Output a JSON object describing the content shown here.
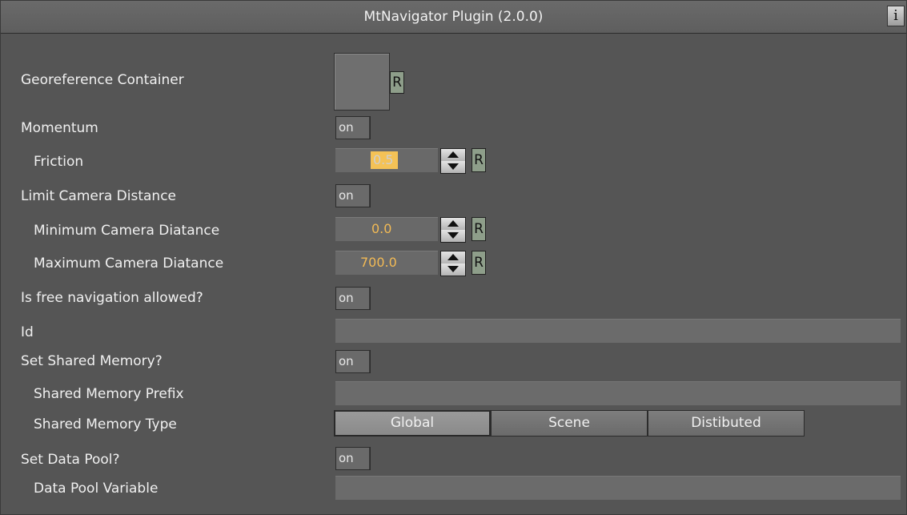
{
  "window": {
    "title": "MtNavigator Plugin (2.0.0)",
    "info_label": "i"
  },
  "rows": {
    "georeference": {
      "label": "Georeference Container",
      "reset": "R"
    },
    "momentum": {
      "label": "Momentum",
      "toggle": "on"
    },
    "friction": {
      "label": "Friction",
      "value": "0.5",
      "reset": "R"
    },
    "limit_camera": {
      "label": "Limit Camera Distance",
      "toggle": "on"
    },
    "min_camera": {
      "label": "Minimum Camera Diatance",
      "value": "0.0",
      "reset": "R"
    },
    "max_camera": {
      "label": "Maximum Camera Diatance",
      "value": "700.0",
      "reset": "R"
    },
    "free_nav": {
      "label": "Is free navigation allowed?",
      "toggle": "on"
    },
    "id": {
      "label": "Id",
      "value": ""
    },
    "shared_memory": {
      "label": "Set Shared Memory?",
      "toggle": "on"
    },
    "shared_prefix": {
      "label": "Shared Memory Prefix",
      "value": ""
    },
    "shared_type": {
      "label": "Shared Memory Type",
      "options": [
        "Global",
        "Scene",
        "Distibuted"
      ],
      "selected": "Global"
    },
    "data_pool": {
      "label": "Set Data Pool?",
      "toggle": "on"
    },
    "data_pool_var": {
      "label": "Data Pool Variable",
      "value": ""
    }
  },
  "colors": {
    "panel_bg": "#555555",
    "value_text": "#f2ba55",
    "value_highlight": "#f4c256"
  },
  "icons": [
    "info-icon",
    "spin-up-icon",
    "spin-down-icon"
  ]
}
